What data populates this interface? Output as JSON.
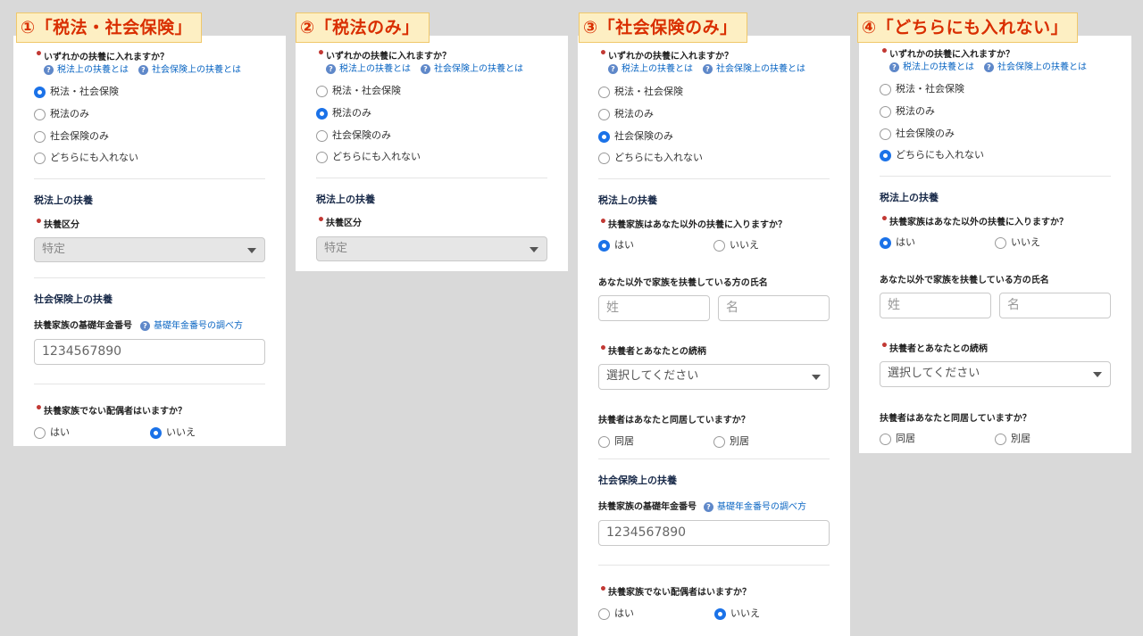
{
  "tags": [
    "①「税法・社会保険」",
    "②「税法のみ」",
    "③「社会保険のみ」",
    "④「どちらにも入れない」"
  ],
  "q_dependent": "いずれかの扶養に入れますか？",
  "link_tax": "税法上の扶養とは",
  "link_social": "社会保険上の扶養とは",
  "opt_both": "税法・社会保険",
  "opt_tax": "税法のみ",
  "opt_social": "社会保険のみ",
  "opt_neither": "どちらにも入れない",
  "sec_tax": "税法上の扶養",
  "q_category": "扶養区分",
  "category_value": "特定",
  "sec_social": "社会保険上の扶養",
  "q_pension": "扶養家族の基礎年金番号",
  "link_pension": "基礎年金番号の調べ方",
  "pension_value": "1234567890",
  "q_spouse": "扶養家族でない配偶者はいますか？",
  "yes": "はい",
  "no": "いいえ",
  "q_other": "扶養家族はあなた以外の扶養に入りますか？",
  "q_other_name": "あなた以外で家族を扶養している方の氏名",
  "ph_last": "姓",
  "ph_first": "名",
  "q_relation": "扶養者とあなたとの続柄",
  "relation_placeholder": "選択してください",
  "q_cohabit": "扶養者はあなたと同居していますか？",
  "cohabit_same": "同居",
  "cohabit_separate": "別居"
}
